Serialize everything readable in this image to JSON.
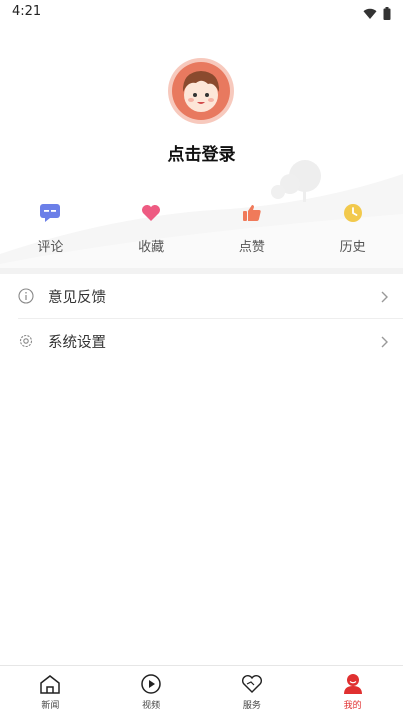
{
  "status_bar": {
    "time": "4:21",
    "icons": [
      "wifi-icon",
      "battery-icon"
    ]
  },
  "profile": {
    "avatar": "avatar-cartoon",
    "login_text": "点击登录"
  },
  "quick_actions": [
    {
      "label": "评论",
      "icon": "comment-icon",
      "color": "#6b7fe8"
    },
    {
      "label": "收藏",
      "icon": "heart-icon",
      "color": "#ee5b82"
    },
    {
      "label": "点赞",
      "icon": "thumb-up-icon",
      "color": "#f07a5a"
    },
    {
      "label": "历史",
      "icon": "clock-icon",
      "color": "#f2c94c"
    }
  ],
  "menu": [
    {
      "label": "意见反馈",
      "icon": "info-icon"
    },
    {
      "label": "系统设置",
      "icon": "gear-icon"
    }
  ],
  "bottom_nav": {
    "items": [
      {
        "label": "新闻",
        "icon": "home-icon"
      },
      {
        "label": "视频",
        "icon": "play-icon"
      },
      {
        "label": "服务",
        "icon": "service-heart-icon"
      },
      {
        "label": "我的",
        "icon": "user-icon"
      }
    ],
    "active": "我的",
    "active_color": "#e03030"
  }
}
